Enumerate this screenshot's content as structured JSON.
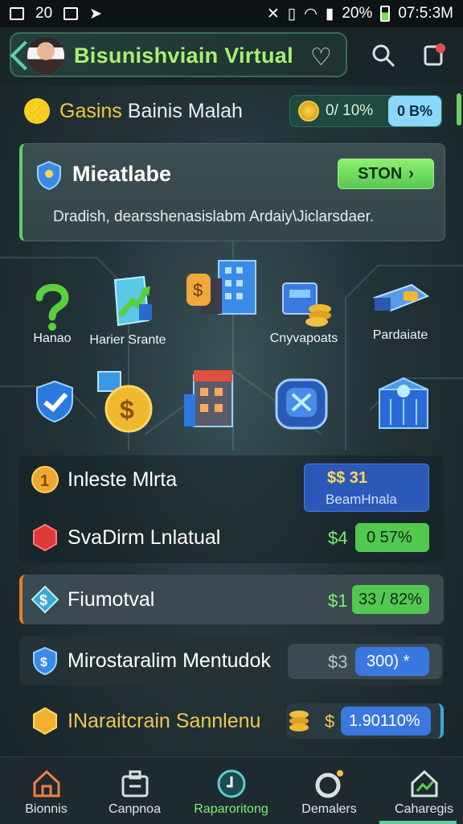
{
  "status_bar": {
    "left_text": "20",
    "battery": "20%",
    "time": "07:5:3M"
  },
  "header": {
    "title": "Bisunishviain Virtual"
  },
  "top_row": {
    "label_yellow": "Gasins",
    "label_white": "Bainis Malah",
    "coin_value": "0/ 10%",
    "badge": "0 B%"
  },
  "feature_card": {
    "title": "Mieatlabe",
    "button": "STON",
    "description": "Dradish, dearsshenasislabm Ardaiy\\Jiclarsdaer."
  },
  "grid": [
    {
      "label": "Hanao",
      "icon": "question-icon"
    },
    {
      "label": "Harier Srante",
      "icon": "growth-chart-icon"
    },
    {
      "label": "",
      "icon": "buildings-icon"
    },
    {
      "label": "Cnyvapoats",
      "icon": "cash-register-icon"
    },
    {
      "label": "Pardaiate",
      "icon": "cash-stack-icon"
    },
    {
      "label": "",
      "icon": "shield-check-icon"
    },
    {
      "label": "",
      "icon": "coin-card-icon"
    },
    {
      "label": "",
      "icon": "store-building-icon"
    },
    {
      "label": "",
      "icon": "wallet-icon"
    },
    {
      "label": "",
      "icon": "vault-icon"
    }
  ],
  "rows": {
    "invest": {
      "label": "Inleste Mlrta",
      "value": "$$ 31",
      "sub": "BeamHnala"
    },
    "svadim": {
      "label": "SvaDirm Lnlatual",
      "value": "$4",
      "pill": "0   57%"
    },
    "fiumotval": {
      "label": "Fiumotval",
      "value": "$1",
      "pill": "33 / 82%"
    },
    "mirostaralin": {
      "label": "Mirostaralim Mentudok",
      "value": "$3",
      "pill": "300) *"
    },
    "naraitcran": {
      "label": "INaraitcrain Sannlenu",
      "value": "$",
      "pill": "1.90110%"
    }
  },
  "nav": [
    {
      "label": "Bionnis",
      "icon": "home-icon"
    },
    {
      "label": "Canpnoa",
      "icon": "briefcase-icon"
    },
    {
      "label": "Raparoritong",
      "icon": "compass-icon"
    },
    {
      "label": "Demalers",
      "icon": "globe-icon"
    },
    {
      "label": "Caharegis",
      "icon": "house-chart-icon"
    }
  ],
  "colors": {
    "accent_green": "#7ef070",
    "accent_blue": "#3a78e0",
    "accent_yellow": "#f0c850"
  }
}
